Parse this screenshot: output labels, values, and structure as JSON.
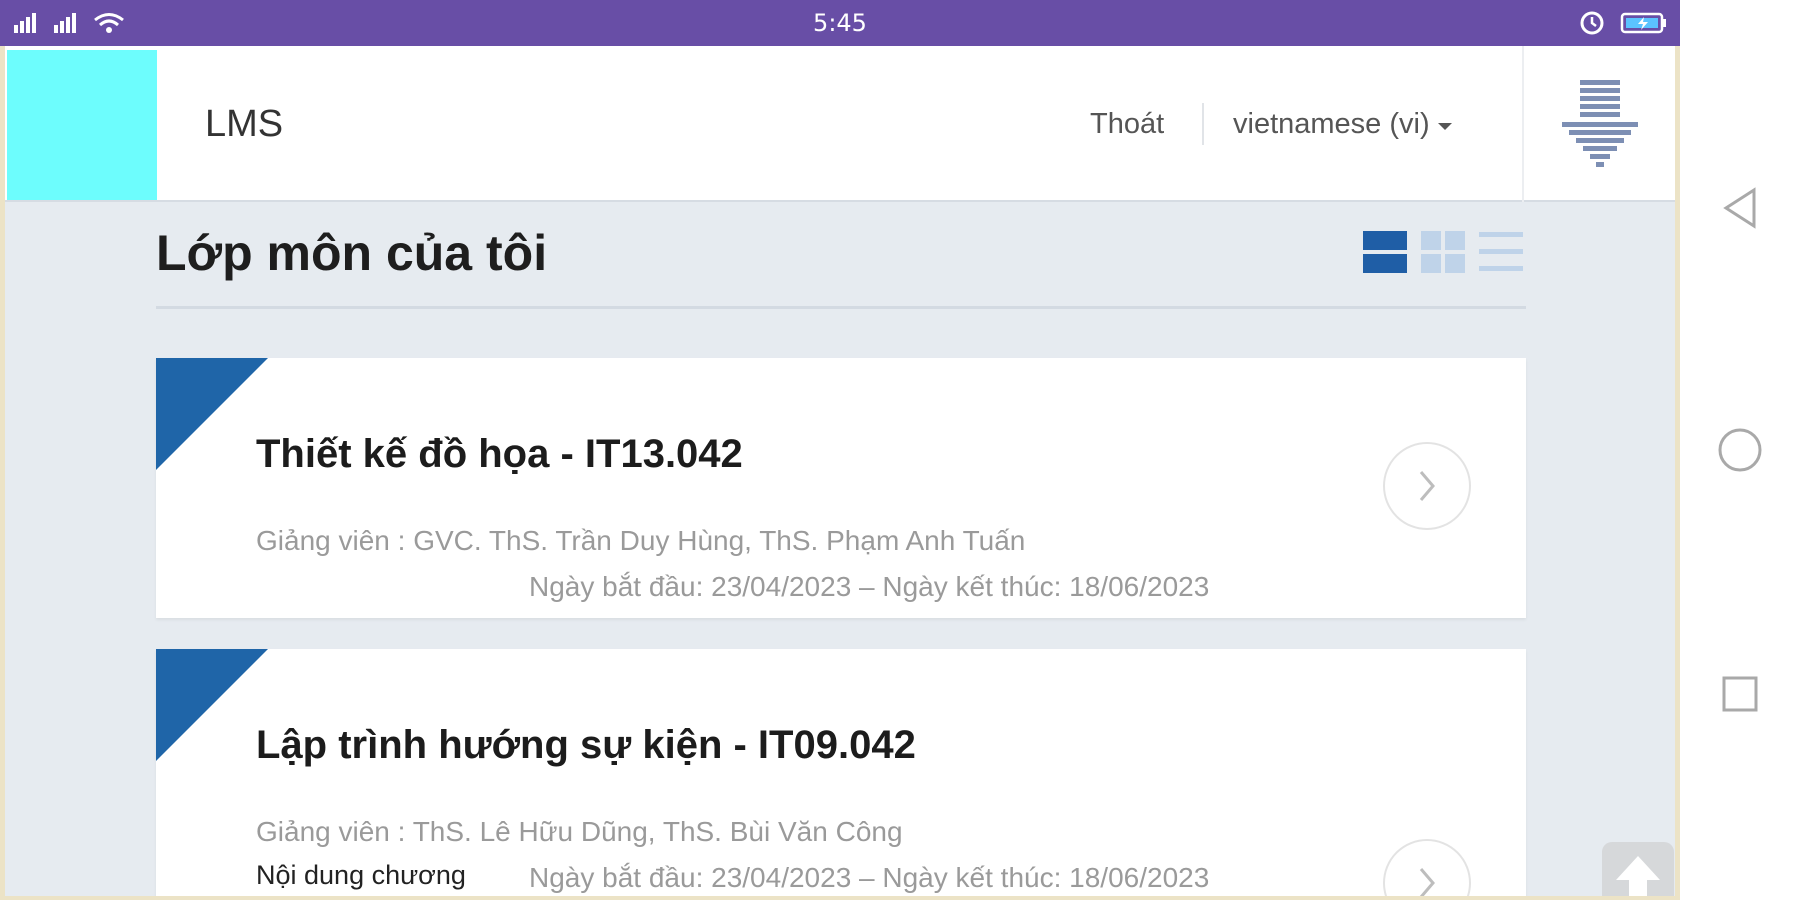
{
  "status_bar": {
    "time": "5:45"
  },
  "header": {
    "brand": "LMS",
    "logout_label": "Thoát",
    "language_selected": "vietnamese (vi)"
  },
  "page": {
    "title": "Lớp môn của tôi"
  },
  "courses": [
    {
      "title": "Thiết kế đồ họa - IT13.042",
      "teacher": "Giảng viên : GVC. ThS. Trần Duy Hùng, ThS. Phạm Anh Tuấn",
      "dates": "Ngày bắt đầu: 23/04/2023 – Ngày kết thúc: 18/06/2023"
    },
    {
      "title": "Lập trình hướng sự kiện - IT09.042",
      "teacher": "Giảng viên : ThS. Lê Hữu Dũng, ThS. Bùi Văn Công",
      "content_link": "Nội dung chương",
      "dates": "Ngày bắt đầu: 23/04/2023 – Ngày kết thúc: 18/06/2023"
    }
  ],
  "colors": {
    "status_bar": "#684ea6",
    "logo_block": "#6dfdfd",
    "card_corner": "#1f65a8",
    "page_background": "#e6ebf0"
  },
  "icons": {
    "download": "download-arrow-icon",
    "view_card": "card-view-icon",
    "view_grid": "grid-view-icon",
    "view_list": "list-view-icon",
    "course_open": "chevron-right-icon",
    "scroll_top": "arrow-up-icon",
    "nav_back": "triangle-back-icon",
    "nav_home": "circle-home-icon",
    "nav_recents": "square-recents-icon"
  }
}
